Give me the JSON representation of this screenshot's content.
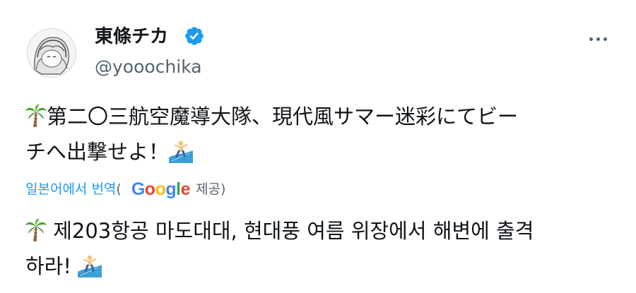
{
  "user": {
    "display_name": "東條チカ",
    "handle": "@yooochika",
    "verified": true,
    "verified_color": "#1d9bf0"
  },
  "more_icon": "more-horizontal-icon",
  "tweet": {
    "original_line1": "第二〇三航空魔導大隊、現代風サマー迷彩にてビー",
    "original_line2": "チへ出撃せよ！",
    "emoji_start": "palm-tree-icon",
    "emoji_end": "surfer-icon"
  },
  "translation": {
    "link_text": "일본어에서 번역",
    "open_paren": "(",
    "provider": "Google",
    "provided_label": "제공)",
    "line1": "제203항공 마도대대, 현대풍 여름 위장에서 해변에 출격",
    "line2": "하라!",
    "link_color": "#1d9bf0"
  }
}
